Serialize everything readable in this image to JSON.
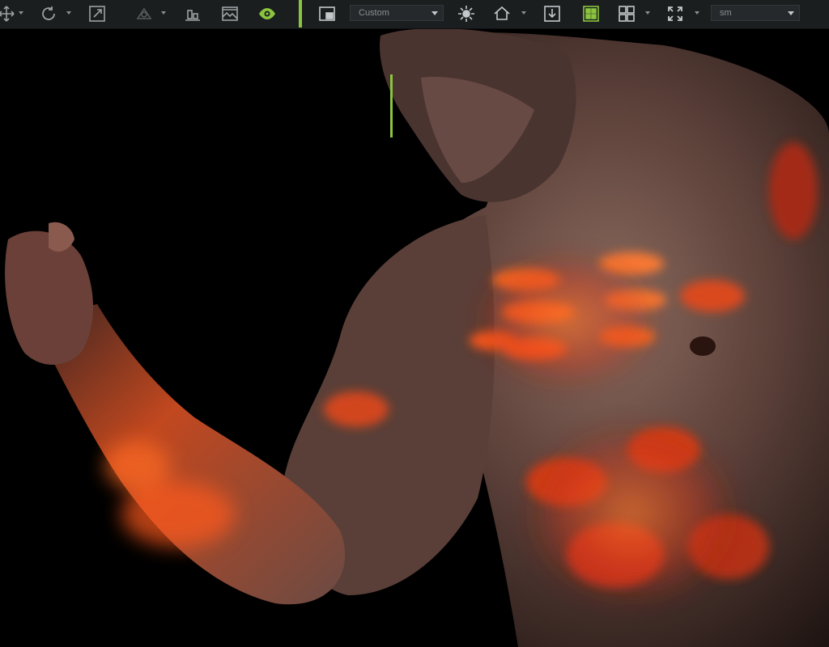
{
  "toolbar": {
    "items": [
      {
        "name": "move-icon"
      },
      {
        "name": "rotate-icon"
      },
      {
        "name": "scale-icon"
      },
      {
        "name": "gizmo-icon"
      },
      {
        "name": "align-floor-icon"
      },
      {
        "name": "image-icon"
      },
      {
        "name": "eye-icon"
      },
      {
        "name": "camera-view-icon"
      },
      {
        "name": "light-icon"
      },
      {
        "name": "home-icon"
      },
      {
        "name": "download-icon"
      },
      {
        "name": "grid-icon"
      },
      {
        "name": "layout-icon"
      },
      {
        "name": "fit-icon"
      }
    ],
    "camera_dropdown": {
      "value": "Custom"
    },
    "render_dropdown": {
      "value": "sm"
    },
    "accent_color": "#8bc43f"
  }
}
